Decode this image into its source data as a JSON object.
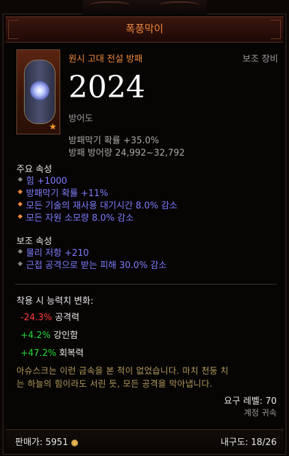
{
  "item": {
    "name": "폭풍막이",
    "type": "원시 고대 전설 방패",
    "slot": "보조 장비",
    "armor_value": "2024",
    "armor_label": "방어도",
    "stats": [
      "방패막기 확률 +35.0%",
      "방패 방어량 24,992~32,792"
    ]
  },
  "primary": {
    "heading": "주요 속성",
    "items": [
      {
        "text": "힘 +1000",
        "bullet": "◆"
      },
      {
        "text": "방패막기 확률 +11%",
        "bullet": "◆"
      },
      {
        "text": "모든 기술의 재사용 대기시간 8.0% 감소",
        "bullet": "◆"
      },
      {
        "text": "모든 자원 소모량 8.0% 감소",
        "bullet": "◆"
      }
    ]
  },
  "secondary": {
    "heading": "보조 속성",
    "items": [
      {
        "text": "물리 저항 +210",
        "bullet": "◆"
      },
      {
        "text": "근접 공격으로 받는 피해 30.0% 감소",
        "bullet": "◆"
      }
    ]
  },
  "changes": {
    "heading": "착용 시 능력치 변화:",
    "rows": [
      {
        "value": "-24.3%",
        "label": "공격력"
      },
      {
        "value": "+4.2%",
        "label": "강인함"
      },
      {
        "value": "+47.2%",
        "label": "회복력"
      }
    ]
  },
  "flavor": [
    "아슈스크는 이런 금속을 본 적이 없었습니다. 마치 천둥 치",
    "는 하늘의 힘이라도 서린 듯, 모든 공격을 막아냅니다."
  ],
  "requirement": "요구 레벨: 70",
  "bind": "계정 귀속",
  "footer": {
    "sell": "판매가: 5951",
    "durability": "내구도: 18/26"
  },
  "colors": {
    "legendary": "#f08a3c",
    "magic": "#7d7dff",
    "negative": "#ff3b3b",
    "positive": "#22d83a"
  }
}
